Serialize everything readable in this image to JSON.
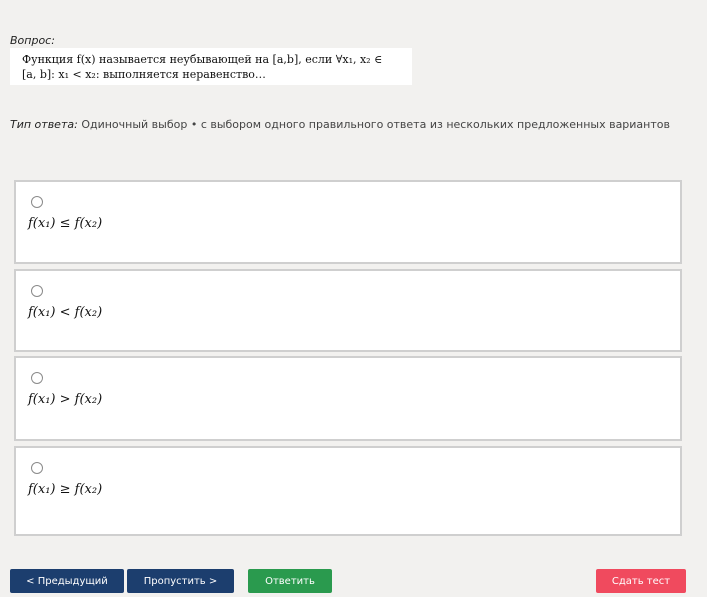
{
  "question": {
    "label": "Вопрос:",
    "line1": "Функция  f(x)  называется  неубывающей  на  [a,b],  если  ∀x₁, x₂ ∈",
    "line2": "[a, b]: x₁ < x₂: выполняется неравенство…"
  },
  "answer_type": {
    "label": "Тип ответа:",
    "value": "Одиночный выбор • с выбором одного правильного ответа из нескольких предложенных вариантов"
  },
  "options": [
    {
      "text": "f(x₁) ≤ f(x₂)",
      "selected": false
    },
    {
      "text": "f(x₁) < f(x₂)",
      "selected": false
    },
    {
      "text": "f(x₁) > f(x₂)",
      "selected": false
    },
    {
      "text": "f(x₁) ≥ f(x₂)",
      "selected": false
    }
  ],
  "buttons": {
    "prev": "< Предыдущий",
    "skip": "Пропустить >",
    "answer": "Ответить",
    "finish": "Сдать тест"
  },
  "colors": {
    "background": "#f2f1ef",
    "nav_button": "#1c3e6e",
    "answer_button": "#2a9a4e",
    "finish_button": "#f04a5e"
  }
}
